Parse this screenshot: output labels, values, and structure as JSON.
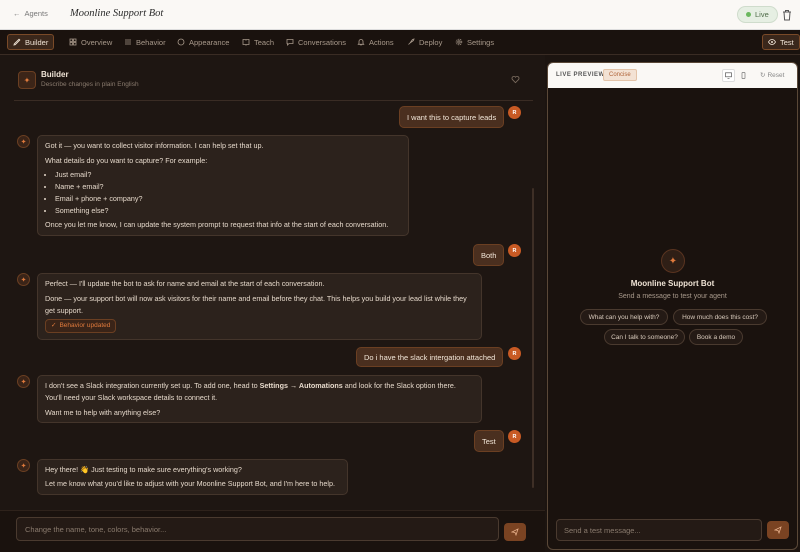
{
  "topbar": {
    "back_label": "Agents",
    "bot_name": "Moonline Support Bot",
    "status": "Live"
  },
  "nav": {
    "tabs": [
      {
        "label": "Builder",
        "icon": "pencil-icon",
        "active": true
      },
      {
        "label": "Overview",
        "icon": "grid-icon"
      },
      {
        "label": "Behavior",
        "icon": "sliders-icon"
      },
      {
        "label": "Appearance",
        "icon": "palette-icon"
      },
      {
        "label": "Teach",
        "icon": "book-icon"
      },
      {
        "label": "Conversations",
        "icon": "chat-icon"
      },
      {
        "label": "Actions",
        "icon": "bell-icon"
      },
      {
        "label": "Deploy",
        "icon": "rocket-icon"
      },
      {
        "label": "Settings",
        "icon": "gear-icon"
      }
    ],
    "test_label": "Test"
  },
  "builder": {
    "title": "Builder",
    "subtitle": "Describe changes in plain English",
    "messages": {
      "u1": "I want this to capture leads",
      "b1_intro": "Got it — you want to collect visitor information. I can help set that up.",
      "b1_question": "What details do you want to capture? For example:",
      "b1_options": [
        "Just email?",
        "Name + email?",
        "Email + phone + company?",
        "Something else?"
      ],
      "b1_outro": "Once you let me know, I can update the system prompt to request that info at the start of each conversation.",
      "u2": "Both",
      "b2_line1": "Perfect — I'll update the bot to ask for name and email at the start of each conversation.",
      "b2_line2": "Done — your support bot will now ask visitors for their name and email before they chat. This helps you build your lead list while they get support.",
      "b2_badge": "Behavior updated",
      "u3": "Do i have the slack intergation attached",
      "b3_pre": "I don't see a Slack integration currently set up. To add one, head to ",
      "b3_bold": "Settings → Automations",
      "b3_post": " and look for the Slack option there. You'll need your Slack workspace details to connect it.",
      "b3_line2": "Want me to help with anything else?",
      "u4": "Test",
      "b4_line1": "Hey there! 👋 Just testing to make sure everything's working?",
      "b4_line2": "Let me know what you'd like to adjust with your Moonline Support Bot, and I'm here to help."
    },
    "user_initial": "R",
    "input_placeholder": "Change the name, tone, colors, behavior..."
  },
  "preview": {
    "title": "LIVE PREVIEW",
    "mode": "Concise",
    "reset_label": "Reset",
    "bot_name": "Moonline Support Bot",
    "subtitle": "Send a message to test your agent",
    "suggestions": [
      "What can you help with?",
      "How much does this cost?",
      "Can I talk to someone?",
      "Book a demo"
    ],
    "input_placeholder": "Send a test message..."
  },
  "colors": {
    "accent": "#e07a3c",
    "background": "#1c1410",
    "live_green": "#6bb85f"
  }
}
